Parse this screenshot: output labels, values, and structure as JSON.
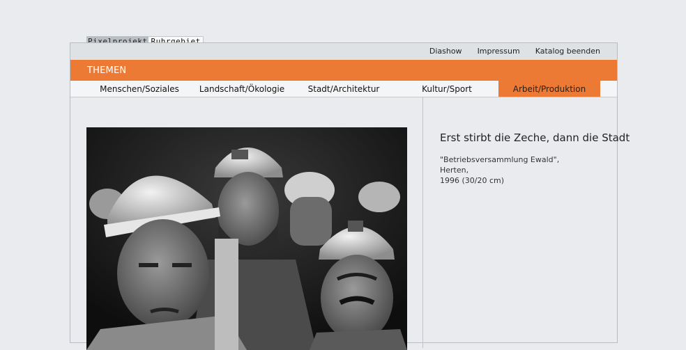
{
  "logo": {
    "part1": "Pixelprojekt",
    "part2": "Ruhrgebiet"
  },
  "topnav": {
    "diashow": "Diashow",
    "impressum": "Impressum",
    "katalog": "Katalog beenden"
  },
  "section": {
    "label": "THEMEN"
  },
  "tabs": [
    {
      "label": "Menschen/Soziales"
    },
    {
      "label": "Landschaft/Ökologie"
    },
    {
      "label": "Stadt/Architektur"
    },
    {
      "label": "Kultur/Sport"
    },
    {
      "label": "Arbeit/Produktion",
      "active": true
    }
  ],
  "photo": {
    "title": "Erst stirbt die Zeche, dann die Stadt",
    "caption_line1": "\"Betriebsversammlung Ewald\", Herten,",
    "caption_line2": "1996 (30/20 cm)"
  },
  "colors": {
    "accent": "#ec7a35",
    "background": "#e9ebee"
  }
}
